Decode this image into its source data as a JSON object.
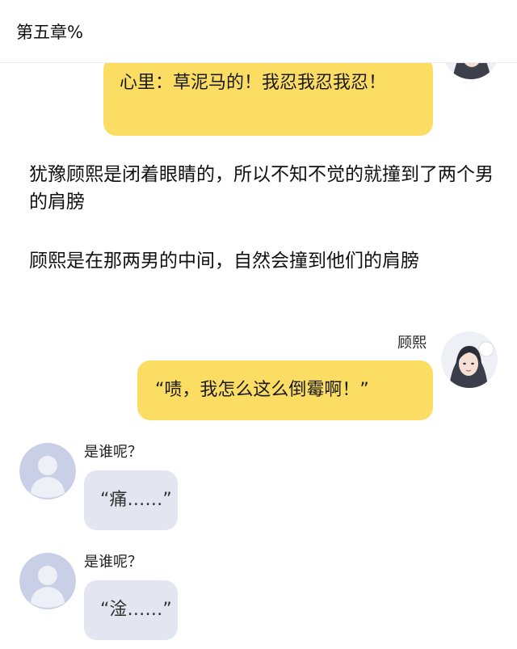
{
  "header": {
    "title": "第五章%"
  },
  "messages": {
    "top_bubble": "心里：草泥马的！我忍我忍我忍！",
    "narration_1": "犹豫顾熙是闭着眼睛的，所以不知不觉的就撞到了两个男的肩膀",
    "narration_2": "顾熙是在那两男的中间，自然会撞到他们的肩膀",
    "gu_xi": {
      "name": "顾熙",
      "text": "“啧，我怎么这么倒霉啊！”"
    },
    "unknown_1": {
      "name": "是谁呢？",
      "text": "“痛……”"
    },
    "unknown_2": {
      "name": "是谁呢？",
      "text": "“淦……”"
    }
  },
  "colors": {
    "yellow_bubble": "#fcdd64",
    "gray_bubble": "#e3e6f1",
    "default_avatar": "#c9cfe6"
  },
  "icons": {
    "girl_avatar": "girl-avatar-icon",
    "default_avatar": "person-silhouette-icon"
  }
}
